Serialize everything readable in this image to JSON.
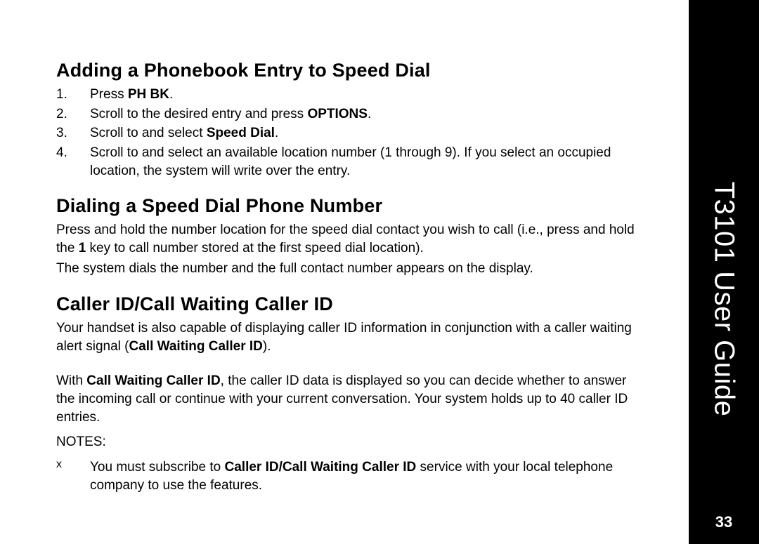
{
  "sidebar": {
    "title": "T3101 User Guide",
    "page": "33"
  },
  "s1": {
    "title": "Adding a Phonebook Entry to Speed Dial",
    "steps": {
      "n1": "1.",
      "t1a": "Press ",
      "t1b": "PH BK",
      "t1c": ".",
      "n2": "2.",
      "t2a": "Scroll to the desired entry and press ",
      "t2b": "OPTIONS",
      "t2c": ".",
      "n3": "3.",
      "t3a": "Scroll to and select ",
      "t3b": "Speed Dial",
      "t3c": ".",
      "n4": "4.",
      "t4": "Scroll to and select an available location number (1 through 9). If you select an occupied location, the system will write over the entry."
    }
  },
  "s2": {
    "title": "Dialing a Speed Dial Phone Number",
    "p1a": "Press and hold the number location for the speed dial contact you wish to call (i.e., press and hold the ",
    "p1b": "1",
    "p1c": " key to call number stored at the first speed dial location).",
    "p2": "The system dials the number and the full contact number appears on the display."
  },
  "s3": {
    "title": "Caller ID/Call Waiting Caller ID",
    "p1a": "Your handset is also capable of displaying caller ID information in conjunction with a caller waiting alert signal (",
    "p1b": "Call Waiting Caller ID",
    "p1c": ").",
    "p2a": "With ",
    "p2b": "Call Waiting Caller ID",
    "p2c": ", the caller ID data is displayed so you can decide whether to answer the incoming call or continue with your current conversation. Your system holds up to 40 caller ID entries.",
    "notesLabel": "NOTES:",
    "note1_bullet": "x",
    "note1a": "You must subscribe to ",
    "note1b": "Caller ID/Call Waiting Caller ID",
    "note1c": " service with your local telephone company to use the features."
  }
}
